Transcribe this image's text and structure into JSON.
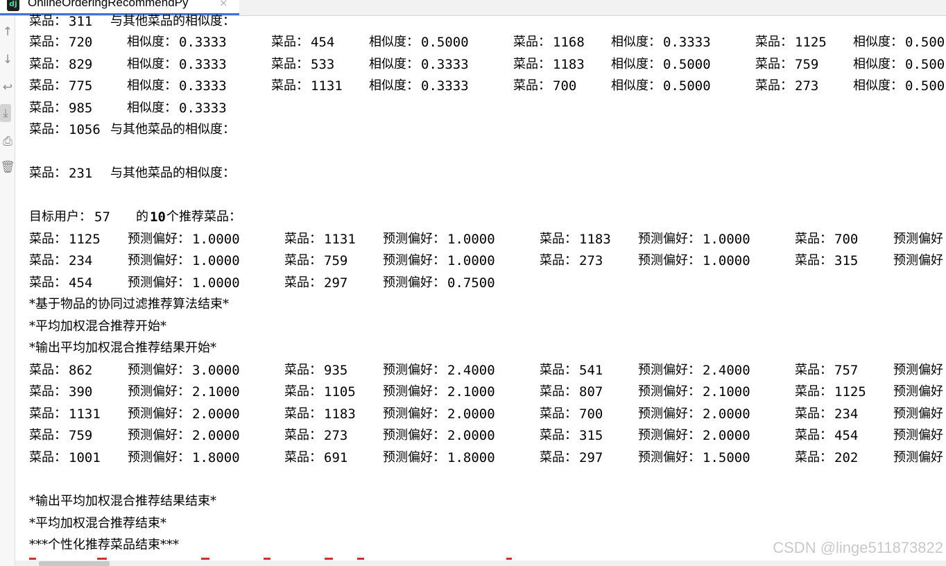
{
  "window": {
    "tab_title": "OnlineOrderingRecommendPy",
    "tab_icon": "pycharm-icon",
    "close_glyph": "×"
  },
  "toolbar": {
    "icons": [
      "up-arrow-icon",
      "down-arrow-icon",
      "soft-wrap-icon",
      "scroll-to-end-icon",
      "print-icon",
      "trash-icon"
    ]
  },
  "console": {
    "partial_top": {
      "label": "菜品：",
      "id": "311",
      "text": "与其他菜品的相似度："
    },
    "similarity_rows": [
      [
        {
          "dish_label": "菜品：",
          "dish": "720",
          "sim_label": "相似度：",
          "sim": "0.3333"
        },
        {
          "dish_label": "菜品：",
          "dish": "454",
          "sim_label": "相似度：",
          "sim": "0.5000"
        },
        {
          "dish_label": "菜品：",
          "dish": "1168",
          "sim_label": "相似度：",
          "sim": "0.3333"
        },
        {
          "dish_label": "菜品：",
          "dish": "1125",
          "sim_label": "相似度：",
          "sim": "0.500"
        }
      ],
      [
        {
          "dish_label": "菜品：",
          "dish": "829",
          "sim_label": "相似度：",
          "sim": "0.3333"
        },
        {
          "dish_label": "菜品：",
          "dish": "533",
          "sim_label": "相似度：",
          "sim": "0.3333"
        },
        {
          "dish_label": "菜品：",
          "dish": "1183",
          "sim_label": "相似度：",
          "sim": "0.5000"
        },
        {
          "dish_label": "菜品：",
          "dish": "759",
          "sim_label": "相似度：",
          "sim": "0.500"
        }
      ],
      [
        {
          "dish_label": "菜品：",
          "dish": "775",
          "sim_label": "相似度：",
          "sim": "0.3333"
        },
        {
          "dish_label": "菜品：",
          "dish": "1131",
          "sim_label": "相似度：",
          "sim": "0.3333"
        },
        {
          "dish_label": "菜品：",
          "dish": "700",
          "sim_label": "相似度：",
          "sim": "0.5000"
        },
        {
          "dish_label": "菜品：",
          "dish": "273",
          "sim_label": "相似度：",
          "sim": "0.500"
        }
      ],
      [
        {
          "dish_label": "菜品：",
          "dish": "985",
          "sim_label": "相似度：",
          "sim": "0.3333"
        }
      ]
    ],
    "dish_1056": {
      "label": "菜品：",
      "id": "1056",
      "text": "与其他菜品的相似度："
    },
    "dish_231": {
      "label": "菜品：",
      "id": "231",
      "text": "与其他菜品的相似度："
    },
    "target_user": {
      "label": "目标用户：",
      "id": "57",
      "pre": "的",
      "count": "10",
      "post": "个推荐菜品："
    },
    "rec_rows": [
      [
        {
          "dish_label": "菜品：",
          "dish": "1125",
          "pref_label": "预测偏好：",
          "pref": "1.0000"
        },
        {
          "dish_label": "菜品：",
          "dish": "1131",
          "pref_label": "预测偏好：",
          "pref": "1.0000"
        },
        {
          "dish_label": "菜品：",
          "dish": "1183",
          "pref_label": "预测偏好：",
          "pref": "1.0000"
        },
        {
          "dish_label": "菜品：",
          "dish": "700",
          "pref_label": "预测偏好",
          "pref": ""
        }
      ],
      [
        {
          "dish_label": "菜品：",
          "dish": "234",
          "pref_label": "预测偏好：",
          "pref": "1.0000"
        },
        {
          "dish_label": "菜品：",
          "dish": "759",
          "pref_label": "预测偏好：",
          "pref": "1.0000"
        },
        {
          "dish_label": "菜品：",
          "dish": "273",
          "pref_label": "预测偏好：",
          "pref": "1.0000"
        },
        {
          "dish_label": "菜品：",
          "dish": "315",
          "pref_label": "预测偏好",
          "pref": ""
        }
      ],
      [
        {
          "dish_label": "菜品：",
          "dish": "454",
          "pref_label": "预测偏好：",
          "pref": "1.0000"
        },
        {
          "dish_label": "菜品：",
          "dish": "297",
          "pref_label": "预测偏好：",
          "pref": "0.7500"
        }
      ]
    ],
    "msg_cf_end": "*基于物品的协同过滤推荐算法结束*",
    "msg_mix_start": "*平均加权混合推荐开始*",
    "msg_output_start": "*输出平均加权混合推荐结果开始*",
    "mix_rows": [
      [
        {
          "dish_label": "菜品：",
          "dish": "862",
          "pref_label": "预测偏好：",
          "pref": "3.0000"
        },
        {
          "dish_label": "菜品：",
          "dish": "935",
          "pref_label": "预测偏好：",
          "pref": "2.4000"
        },
        {
          "dish_label": "菜品：",
          "dish": "541",
          "pref_label": "预测偏好：",
          "pref": "2.4000"
        },
        {
          "dish_label": "菜品：",
          "dish": "757",
          "pref_label": "预测偏好",
          "pref": ""
        }
      ],
      [
        {
          "dish_label": "菜品：",
          "dish": "390",
          "pref_label": "预测偏好：",
          "pref": "2.1000"
        },
        {
          "dish_label": "菜品：",
          "dish": "1105",
          "pref_label": "预测偏好：",
          "pref": "2.1000"
        },
        {
          "dish_label": "菜品：",
          "dish": "807",
          "pref_label": "预测偏好：",
          "pref": "2.1000"
        },
        {
          "dish_label": "菜品：",
          "dish": "1125",
          "pref_label": "预测偏好",
          "pref": ""
        }
      ],
      [
        {
          "dish_label": "菜品：",
          "dish": "1131",
          "pref_label": "预测偏好：",
          "pref": "2.0000"
        },
        {
          "dish_label": "菜品：",
          "dish": "1183",
          "pref_label": "预测偏好：",
          "pref": "2.0000"
        },
        {
          "dish_label": "菜品：",
          "dish": "700",
          "pref_label": "预测偏好：",
          "pref": "2.0000"
        },
        {
          "dish_label": "菜品：",
          "dish": "234",
          "pref_label": "预测偏好",
          "pref": ""
        }
      ],
      [
        {
          "dish_label": "菜品：",
          "dish": "759",
          "pref_label": "预测偏好：",
          "pref": "2.0000"
        },
        {
          "dish_label": "菜品：",
          "dish": "273",
          "pref_label": "预测偏好：",
          "pref": "2.0000"
        },
        {
          "dish_label": "菜品：",
          "dish": "315",
          "pref_label": "预测偏好：",
          "pref": "2.0000"
        },
        {
          "dish_label": "菜品：",
          "dish": "454",
          "pref_label": "预测偏好",
          "pref": ""
        }
      ],
      [
        {
          "dish_label": "菜品：",
          "dish": "1001",
          "pref_label": "预测偏好：",
          "pref": "1.8000"
        },
        {
          "dish_label": "菜品：",
          "dish": "691",
          "pref_label": "预测偏好：",
          "pref": "1.8000"
        },
        {
          "dish_label": "菜品：",
          "dish": "297",
          "pref_label": "预测偏好：",
          "pref": "1.5000"
        },
        {
          "dish_label": "菜品：",
          "dish": "202",
          "pref_label": "预测偏好",
          "pref": ""
        }
      ]
    ],
    "msg_output_end": "*输出平均加权混合推荐结果结束*",
    "msg_mix_end": "*平均加权混合推荐结束*",
    "msg_personal_end": "***个性化推荐菜品结束***"
  },
  "watermark": "CSDN @linge511873822",
  "colors": {
    "tab_underline": "#3d74d6",
    "text": "#000000",
    "watermark": "#c9c9c9",
    "error_mark": "#c83232"
  }
}
